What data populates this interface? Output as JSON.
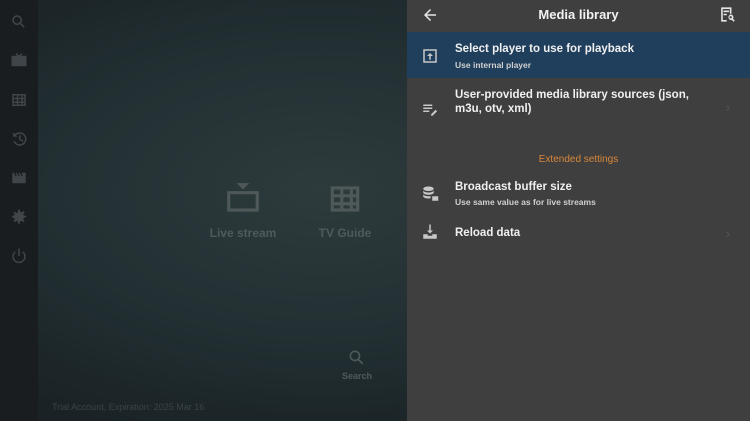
{
  "drawer": {
    "title": "Media library",
    "back_icon": "arrow-left-icon",
    "action_icon": "search-list-icon",
    "items": [
      {
        "icon": "open-external-icon",
        "title": "Select player to use for playback",
        "subtitle": "Use internal player",
        "selected": true
      },
      {
        "icon": "edit-list-icon",
        "title": "User-provided media library sources (json, m3u, otv, xml)",
        "subtitle": ""
      }
    ],
    "section_label": "Extended settings",
    "extended_items": [
      {
        "icon": "database-icon",
        "title": "Broadcast buffer size",
        "subtitle": "Use same value as for live streams"
      },
      {
        "icon": "download-tray-icon",
        "title": "Reload data",
        "subtitle": ""
      }
    ],
    "colors": {
      "selected_bg": "#203f5c",
      "section_label": "#d9883a",
      "drawer_bg": "#3f3f3f"
    }
  },
  "home": {
    "tiles": [
      {
        "label": "Live stream",
        "icon": "tv-icon"
      },
      {
        "label": "TV Guide",
        "icon": "grid-icon"
      },
      {
        "label": "Search",
        "icon": "search-icon"
      }
    ],
    "trial_text": "Trial Account, Expiration: 2025 Mar 16"
  },
  "sidebar": {
    "icons": [
      "search-icon",
      "tv-icon",
      "grid-icon",
      "history-icon",
      "movies-icon",
      "settings-icon",
      "power-icon"
    ]
  }
}
